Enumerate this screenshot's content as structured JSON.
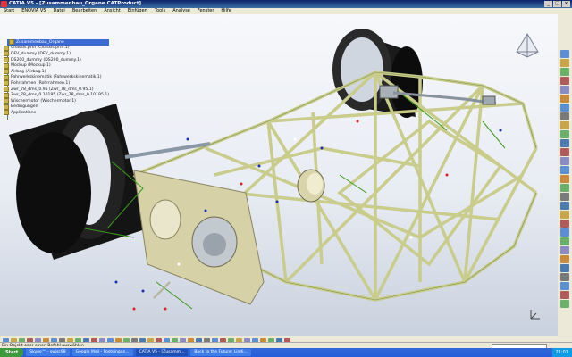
{
  "window": {
    "title": "CATIA V5 - [Zusammenbau_Organe.CATProduct]"
  },
  "menu": [
    "Start",
    "ENOVIA V5",
    "Datei",
    "Bearbeiten",
    "Ansicht",
    "Einfügen",
    "Tools",
    "Analyse",
    "Fenster",
    "Hilfe"
  ],
  "tree": {
    "root": "Zusammenbau_Organe",
    "items": [
      "Chassis.prm (Chassis.prm.1)",
      "DFV_dummy (DFV_dummy.1)",
      "DS200_dummy (DS200_dummy.1)",
      "Mockup (Mockup.1)",
      "Airbag (Airbag.1)",
      "Fahrwerkskinematik (Fahrwerkskinematik.1)",
      "Rohrrahmen (Rohrrahmen.1)",
      "Zwr_78_dms_0.95 (Zwr_78_dms_0.95.1)",
      "Zwr_78_dms_0.10195 (Zwr_78_dms_0.10195.1)",
      "Wischermotor (Wischermotor.1)",
      "Bedingungen",
      "Applications"
    ]
  },
  "status": {
    "message": "Ein Objekt oder einen Befehl auswählen"
  },
  "taskbar": {
    "start": "Start",
    "tasks": [
      "Skype™ - swisc98",
      "Google Mail - Posteingan...",
      "CATIA V5 - [Zusamm...",
      "Back to the Future: Lindi..."
    ],
    "clock": "21:07"
  },
  "colors": {
    "frame": "#e8ecb8",
    "tire": "#111111",
    "panel": "#d6d1a7"
  }
}
